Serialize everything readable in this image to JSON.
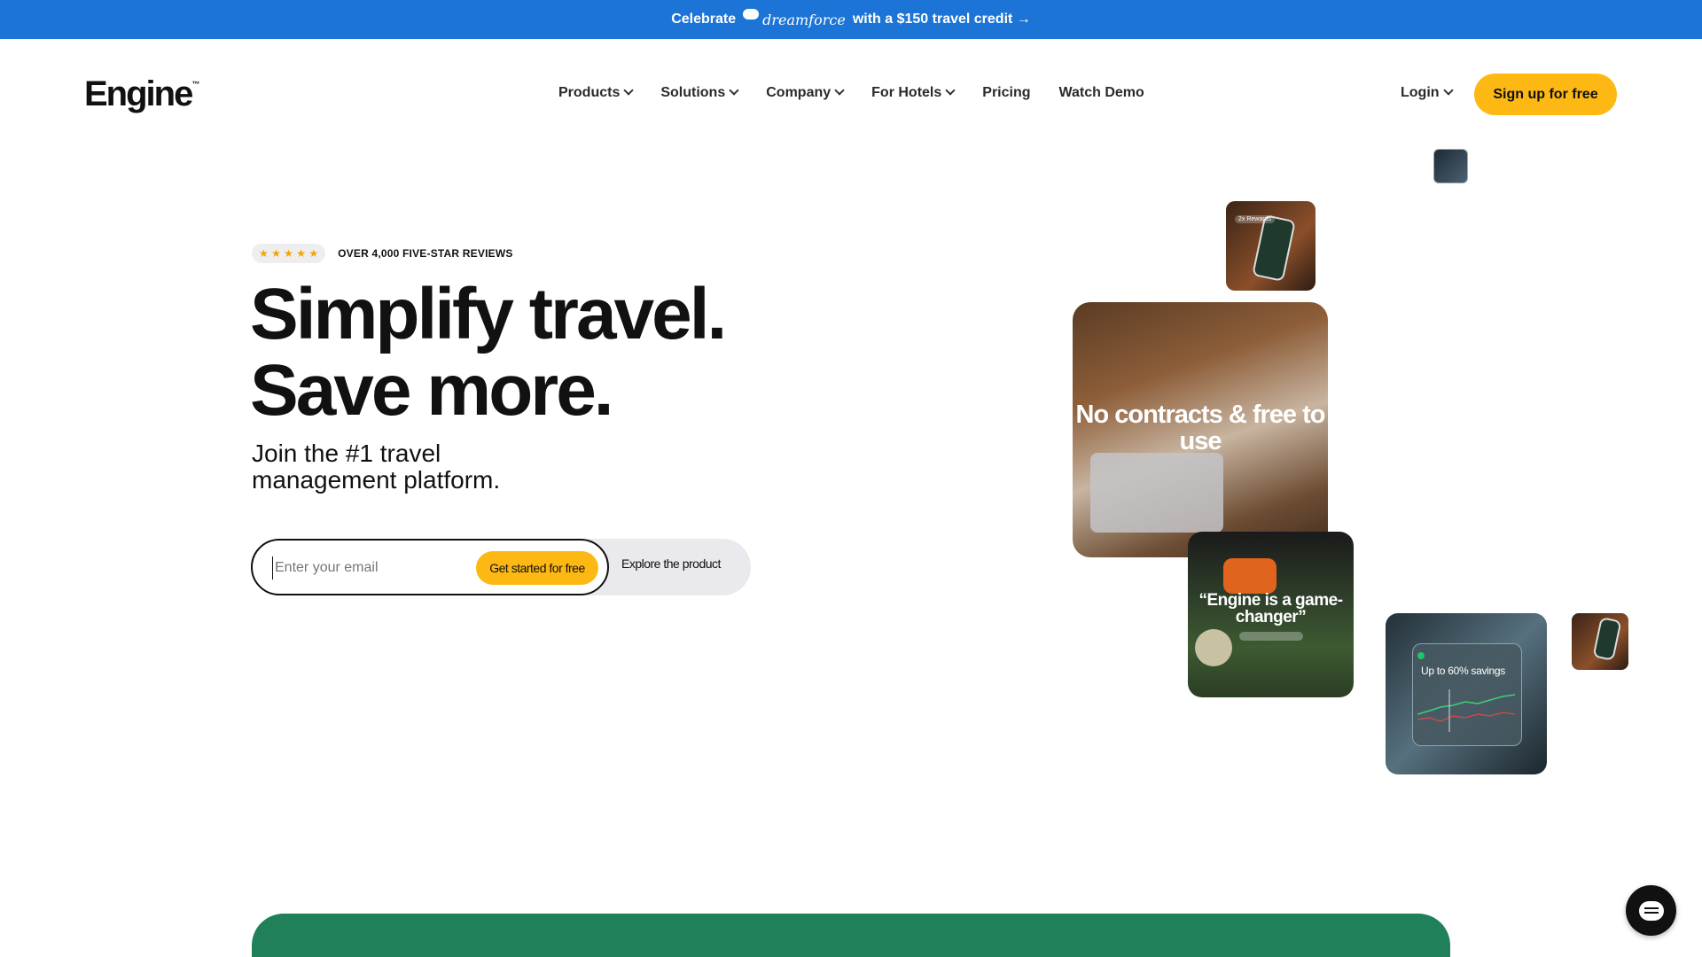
{
  "announcement": {
    "prefix": "Celebrate",
    "brand": "dreamforce",
    "suffix": "with a $150 travel credit →"
  },
  "header": {
    "logo": "Engine",
    "logo_mark": "™",
    "nav": [
      {
        "label": "Products",
        "has_dropdown": true
      },
      {
        "label": "Solutions",
        "has_dropdown": true
      },
      {
        "label": "Company",
        "has_dropdown": true
      },
      {
        "label": "For Hotels",
        "has_dropdown": true
      },
      {
        "label": "Pricing",
        "has_dropdown": false
      },
      {
        "label": "Watch Demo",
        "has_dropdown": false
      }
    ],
    "login": "Login",
    "signup": "Sign up for free"
  },
  "hero": {
    "stars": "★ ★ ★ ★ ★",
    "reviews": "OVER 4,000 FIVE-STAR REVIEWS",
    "headline_line1": "Simplify travel.",
    "headline_line2": "Save more.",
    "subheadline": "Join the #1 travel management platform.",
    "email_placeholder": "Enter your email",
    "cta_primary": "Get started for free",
    "cta_secondary": "Explore the product"
  },
  "tiles": {
    "rewards_label": "2x Rewards",
    "main_text": "No contracts & free to use",
    "quote_text": "“Engine is a game-changer”",
    "savings_text": "Up to 60% savings"
  },
  "colors": {
    "announcement_bg": "#1b74d6",
    "accent_yellow": "#fdb813",
    "green_section": "#20805a"
  }
}
